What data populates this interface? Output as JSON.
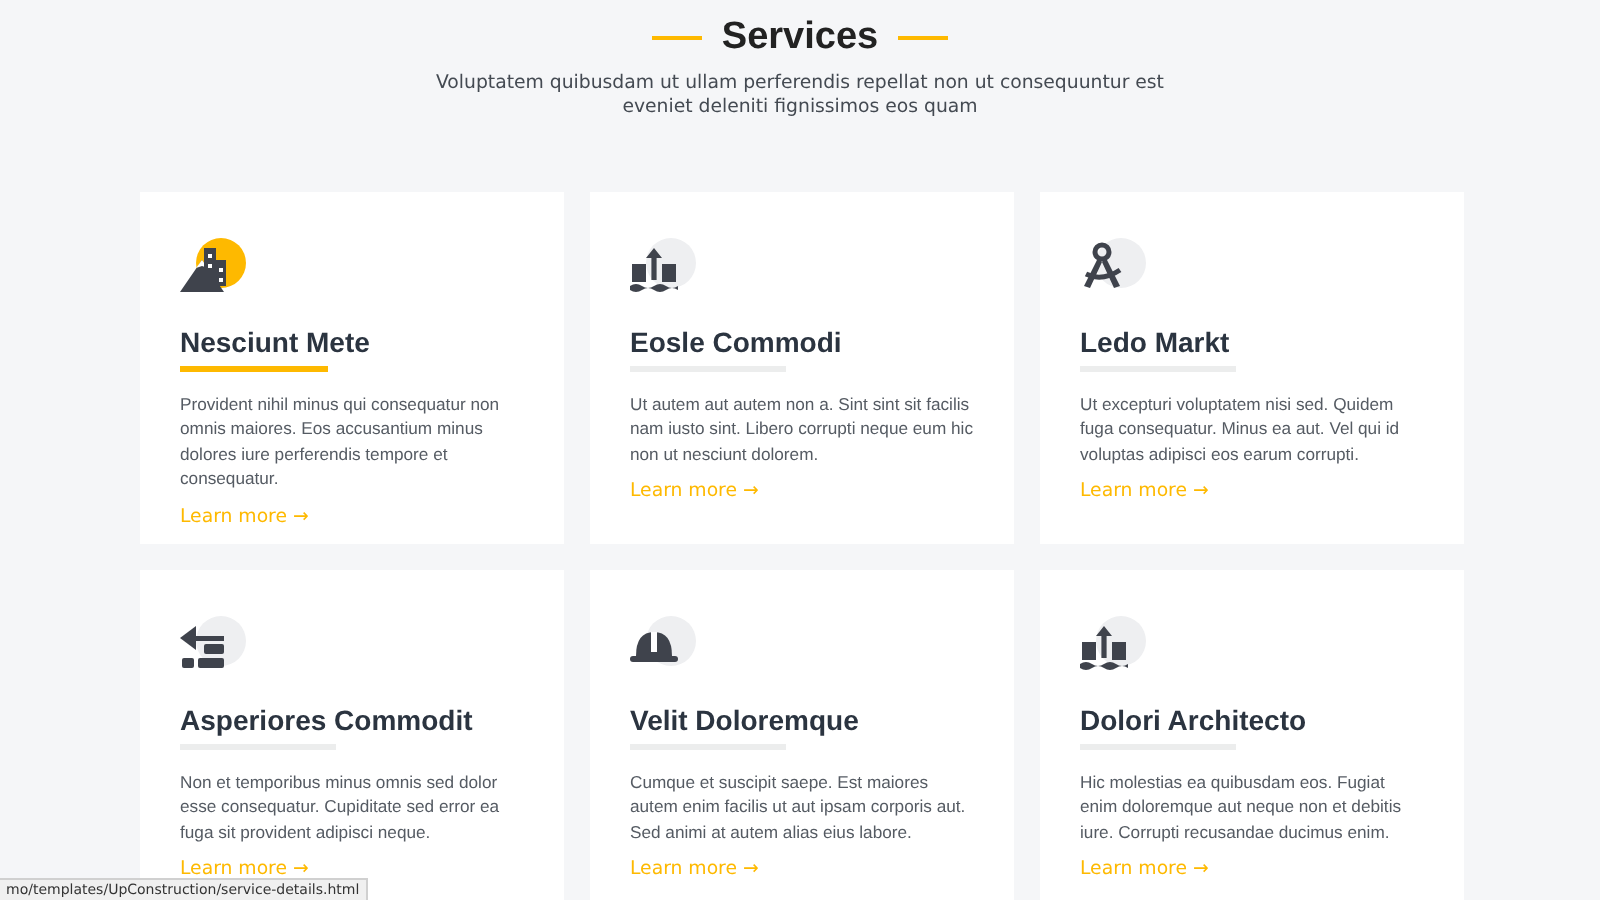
{
  "section": {
    "title": "Services",
    "subtitle": "Voluptatem quibusdam ut ullam perferendis repellat non ut consequuntur est eveniet deleniti fignissimos eos quam"
  },
  "services": [
    {
      "title": "Nesciunt Mete",
      "text": "Provident nihil minus qui consequatur non omnis maiores. Eos accusantium minus dolores iure perferendis tempore et consequatur.",
      "link": "Learn more →",
      "highlighted": true
    },
    {
      "title": "Eosle Commodi",
      "text": "Ut autem aut autem non a. Sint sint sit facilis nam iusto sint. Libero corrupti neque eum hic non ut nesciunt dolorem.",
      "link": "Learn more →",
      "highlighted": false
    },
    {
      "title": "Ledo Markt",
      "text": "Ut excepturi voluptatem nisi sed. Quidem fuga consequatur. Minus ea aut. Vel qui id voluptas adipisci eos earum corrupti.",
      "link": "Learn more →",
      "highlighted": false
    },
    {
      "title": "Asperiores Commodit",
      "text": "Non et temporibus minus omnis sed dolor esse consequatur. Cupiditate sed error ea fuga sit provident adipisci neque.",
      "link": "Learn more →",
      "highlighted": false
    },
    {
      "title": "Velit Doloremque",
      "text": "Cumque et suscipit saepe. Est maiores autem enim facilis ut aut ipsam corporis aut. Sed animi at autem alias eius labore.",
      "link": "Learn more →",
      "highlighted": false
    },
    {
      "title": "Dolori Architecto",
      "text": "Hic molestias ea quibusdam eos. Fugiat enim doloremque aut neque non et debitis iure. Corrupti recusandae ducimus enim.",
      "link": "Learn more →",
      "highlighted": false
    }
  ],
  "status_bar": {
    "url": "mo/templates/UpConstruction/service-details.html"
  }
}
